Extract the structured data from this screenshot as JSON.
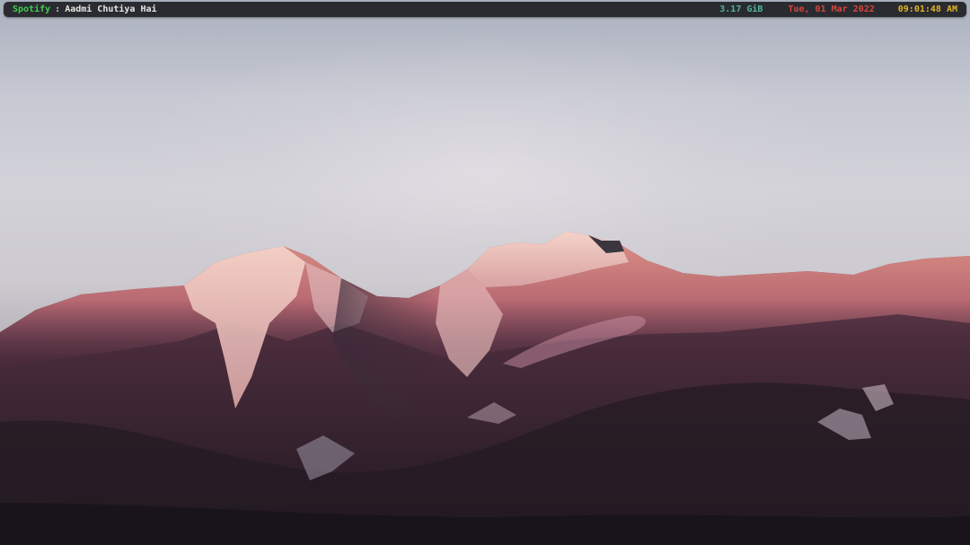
{
  "statusbar": {
    "player": {
      "app": "Spotify",
      "separator": ":",
      "track": "Aadmi Chutiya Hai"
    },
    "memory": "3.17 GiB",
    "date": "Tue, 01 Mar 2022",
    "time": "09:01:48 AM"
  },
  "colors": {
    "bar_background": "#2a2b30",
    "app_name": "#3ecf4f",
    "memory": "#4fb3a0",
    "date": "#d9443a",
    "time": "#e0b22a"
  }
}
